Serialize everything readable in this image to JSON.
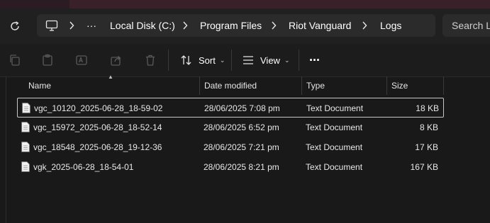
{
  "breadcrumb": {
    "overflow_label": "···",
    "items": [
      "Local Disk (C:)",
      "Program Files",
      "Riot Vanguard",
      "Logs"
    ]
  },
  "search": {
    "placeholder": "Search Logs"
  },
  "toolbar": {
    "sort_label": "Sort",
    "view_label": "View",
    "more_label": "···"
  },
  "columns": {
    "name": "Name",
    "date": "Date modified",
    "type": "Type",
    "size": "Size"
  },
  "files": [
    {
      "name": "vgc_10120_2025-06-28_18-59-02",
      "date": "28/06/2025 7:08 pm",
      "type": "Text Document",
      "size": "18 KB",
      "selected": true
    },
    {
      "name": "vgc_15972_2025-06-28_18-52-14",
      "date": "28/06/2025 6:52 pm",
      "type": "Text Document",
      "size": "8 KB",
      "selected": false
    },
    {
      "name": "vgc_18548_2025-06-28_19-12-36",
      "date": "28/06/2025 7:21 pm",
      "type": "Text Document",
      "size": "17 KB",
      "selected": false
    },
    {
      "name": "vgk_2025-06-28_18-54-01",
      "date": "28/06/2025 8:21 pm",
      "type": "Text Document",
      "size": "167 KB",
      "selected": false
    }
  ]
}
